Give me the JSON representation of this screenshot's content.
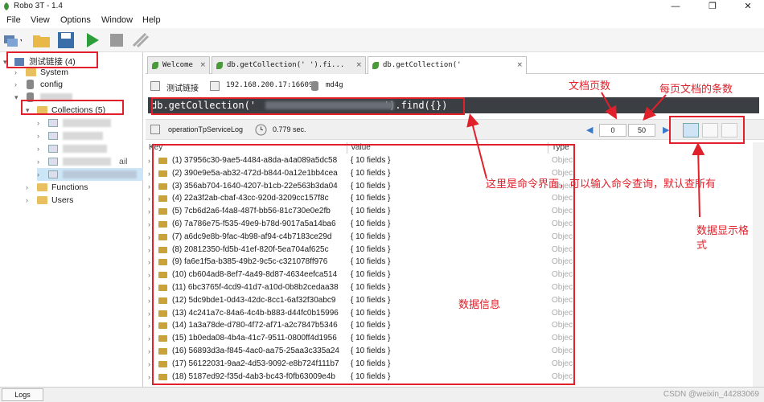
{
  "window": {
    "title": "Robo 3T - 1.4",
    "minimize": "—",
    "maximize": "❐",
    "close": "✕"
  },
  "menu": [
    "File",
    "View",
    "Options",
    "Window",
    "Help"
  ],
  "tree": {
    "connection": "测试链接 (4)",
    "system": "System",
    "config": "config",
    "collections": "Collections (5)",
    "functions": "Functions",
    "users": "Users",
    "partial": "ail"
  },
  "tabs": [
    {
      "label": "Welcome"
    },
    {
      "label": "db.getCollection('                ').fi..."
    },
    {
      "label": "db.getCollection('"
    }
  ],
  "connection_bar": {
    "name": "测试链接",
    "host": "192.168.200.17:16609",
    "db": "md4g"
  },
  "command": "db.getCollection('                      ').find({})",
  "status": {
    "collection": "operationTpServiceLog",
    "time": "0.779 sec."
  },
  "paging": {
    "skip": "0",
    "limit": "50"
  },
  "columns": {
    "key": "Key",
    "value": "Value",
    "type": "Type"
  },
  "rows": [
    {
      "key": "(1) 37956c30-9ae5-4484-a8da-a4a089a5dc58",
      "value": "{ 10 fields }",
      "type": "Objec"
    },
    {
      "key": "(2) 390e9e5a-ab32-472d-b844-0a12e1bb4cea",
      "value": "{ 10 fields }",
      "type": "Objec"
    },
    {
      "key": "(3) 356ab704-1640-4207-b1cb-22e563b3da04",
      "value": "{ 10 fields }",
      "type": "Objec"
    },
    {
      "key": "(4) 22a3f2ab-cbaf-43cc-920d-3209cc157f8c",
      "value": "{ 10 fields }",
      "type": "Objec"
    },
    {
      "key": "(5) 7cb6d2a6-f4a8-487f-bb56-81c730e0e2fb",
      "value": "{ 10 fields }",
      "type": "Objec"
    },
    {
      "key": "(6) 7a786e75-f535-49e9-b78d-9017a5a14ba6",
      "value": "{ 10 fields }",
      "type": "Objec"
    },
    {
      "key": "(7) a6dc9e8b-9fac-4b98-af94-c4b7183ce29d",
      "value": "{ 10 fields }",
      "type": "Objec"
    },
    {
      "key": "(8) 20812350-fd5b-41ef-820f-5ea704af625c",
      "value": "{ 10 fields }",
      "type": "Objec"
    },
    {
      "key": "(9) fa6e1f5a-b385-49b2-9c5c-c321078ff976",
      "value": "{ 10 fields }",
      "type": "Objec"
    },
    {
      "key": "(10) cb604ad8-8ef7-4a49-8d87-4634eefca514",
      "value": "{ 10 fields }",
      "type": "Objec"
    },
    {
      "key": "(11) 6bc3765f-4cd9-41d7-a10d-0b8b2cedaa38",
      "value": "{ 10 fields }",
      "type": "Objec"
    },
    {
      "key": "(12) 5dc9bde1-0d43-42dc-8cc1-6af32f30abc9",
      "value": "{ 10 fields }",
      "type": "Objec"
    },
    {
      "key": "(13) 4c241a7c-84a6-4c4b-b883-d44fc0b15996",
      "value": "{ 10 fields }",
      "type": "Objec"
    },
    {
      "key": "(14) 1a3a78de-d780-4f72-af71-a2c7847b5346",
      "value": "{ 10 fields }",
      "type": "Objec"
    },
    {
      "key": "(15) 1b0eda08-4b4a-41c7-9511-0800ff4d1956",
      "value": "{ 10 fields }",
      "type": "Objec"
    },
    {
      "key": "(16) 56893d3a-f845-4ac0-aa75-25aa3c335a24",
      "value": "{ 10 fields }",
      "type": "Objec"
    },
    {
      "key": "(17) 56122031-9aa2-4d53-9092-e8b724f111b7",
      "value": "{ 10 fields }",
      "type": "Objec"
    },
    {
      "key": "(18) 5187ed92-f35d-4ab3-bc43-f0fb63009e4b",
      "value": "{ 10 fields }",
      "type": "Objec"
    }
  ],
  "annotations": {
    "pages": "文档页数",
    "per_page": "每页文档的条数",
    "command": "这里是命令界面，可以输入命令查询，默认查所有",
    "format_1": "数据显示格",
    "format_2": "式",
    "data": "数据信息"
  },
  "bottom": {
    "logs": "Logs",
    "watermark": "CSDN @weixin_44283069"
  },
  "colors": {
    "annotation": "#e0202a",
    "command_bg": "#3b3f44",
    "folder": "#e8c060"
  }
}
